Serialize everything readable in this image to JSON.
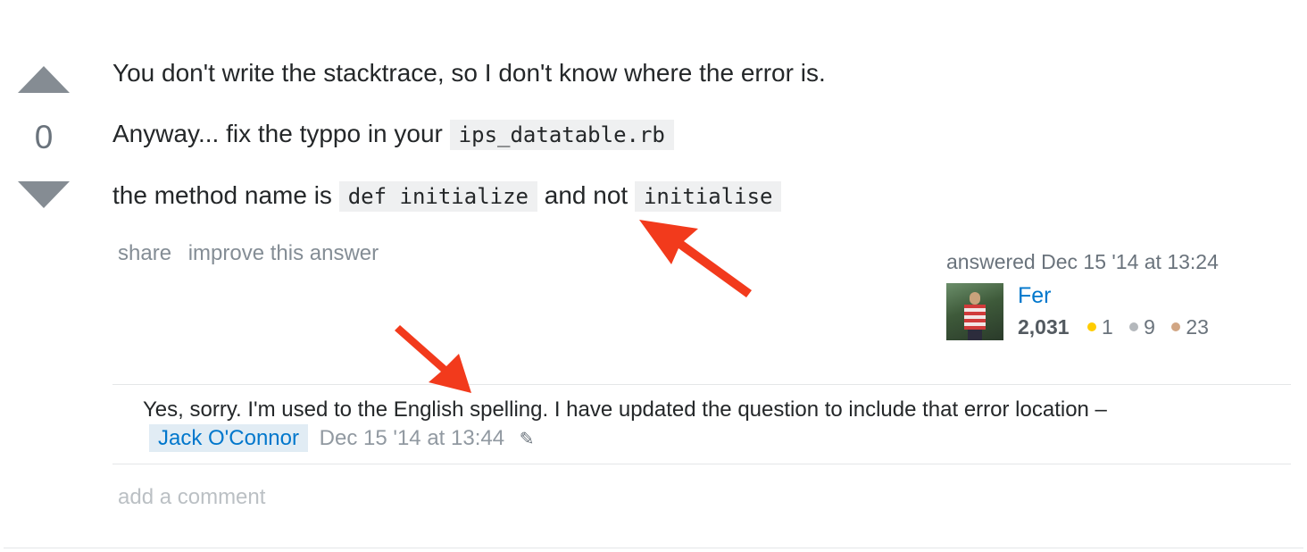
{
  "vote": {
    "count": "0",
    "up_icon": "triangle-up",
    "down_icon": "triangle-down"
  },
  "answer": {
    "line1": "You don't write the stacktrace, so I don't know where the error is.",
    "line2_prefix": "Anyway... fix the typpo in your ",
    "line2_code": "ips_datatable.rb",
    "line3_prefix": "the method name is ",
    "line3_code1": "def initialize",
    "line3_middle": " and not ",
    "line3_code2": "initialise"
  },
  "post_menu": {
    "share": "share",
    "improve": "improve this answer"
  },
  "user": {
    "action": "answered Dec 15 '14 at 13:24",
    "name": "Fer",
    "reputation": "2,031",
    "gold": "1",
    "silver": "9",
    "bronze": "23"
  },
  "comment": {
    "text": "Yes, sorry. I'm used to the English spelling. I have updated the question to include that error location –",
    "user": "Jack O'Connor",
    "date": "Dec 15 '14 at 13:44",
    "edit_icon": "pencil-icon"
  },
  "add_comment": "add a comment",
  "colors": {
    "link": "#0077cc",
    "annotation_arrow": "#f23a1c",
    "gold": "#ffcc01",
    "silver": "#b4b8bc",
    "bronze": "#d1a684"
  }
}
